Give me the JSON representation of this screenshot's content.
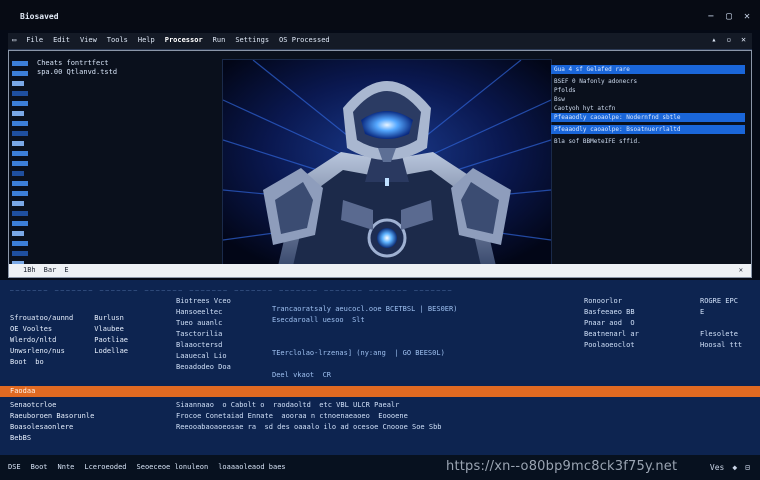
{
  "window": {
    "title": "Biosaved",
    "controls": [
      "−",
      "▢",
      "✕"
    ]
  },
  "toolbar": {
    "items": [
      "▭",
      "File",
      "Edit",
      "View",
      "Tools",
      "Help",
      "Processor",
      "Run",
      "Settings",
      "OS Processed"
    ],
    "right": [
      "▴",
      "▫",
      "✕"
    ]
  },
  "top_panel": {
    "info_lines": [
      "Cheats fontrtfect",
      "spa.00 Qtlanvd.tstd"
    ],
    "right_info": [
      {
        "text": "Gua 4 sf Gelafed rare",
        "style": "blue"
      },
      {
        "text": "BSEF 0 Nafonly adonecrs",
        "style": "dark"
      },
      {
        "text": "Pfolds",
        "style": "dark"
      },
      {
        "text": "Bsw",
        "style": "dark"
      },
      {
        "text": "Caotyoh hyt atcfn",
        "style": "dark"
      },
      {
        "text": "Pfeaaodly caoaolpe: Nodernfnd sbtle",
        "style": "blue"
      },
      {
        "text": "Pfeaaodly caoaolpe: Bsoatnuerrlaltd",
        "style": "blue"
      },
      {
        "text": "Bla sof BBMeteIFE sffid.",
        "style": "dark"
      }
    ],
    "status_items": [
      "1Bh",
      "Bar",
      "E"
    ],
    "status_close": "✕"
  },
  "bottom_panel": {
    "separator": "_______  _______  _______  _______  _______  _______  _______  _______  _______  _______",
    "col1": "\nSfrouatoo/aunnd     Burlusn\nOE Vooltes          Vlaubee\nWlerdo/nltd         Paotliae\nUnwsrleno/nus       Lodellae\nBoot  bo",
    "col2": "Biotrees Vceo\nHansoeeltec\nTueo auanlc\nTasctorilia\nBlaaoctersd\nLaauecal Lio\nBeoadodeo Doa",
    "col3": "Trancaoratsaly aeucocl.ooe BCETBSL | BES0ER)\nEsecdaroall uesoo  Slt\n\n\nTEerclolao-lrzenas] (ny:ang  | GO BEES0L)\n\nDeel vkaot  CR",
    "col4": "Ronoorlor\nBasfeeaeo BB\nPnaar aod  O\nBeatnenarl ar\nPoolaoeoclot",
    "col5": "ROGRE EPC\nE\n\nFlesolete\nHoosal ttt",
    "orange_label": "Faodaa",
    "lower_col1": "Senaotcrloe\nRaeuboroen Basorunle\nBoasolesaonlere\nBebBS",
    "lower_col2": "Siaannaao  o Cabolt o  raodaoltd  etc VBL ULCR Paealr\nFrocoe Conetaiad Ennate  aooraa n ctnoenaeaoeo  Eoooene\nReeooabaoaoeosae ra  sd des oaaalo ilo ad ocesoe Cnoooe Soe Sbb"
  },
  "taskbar": {
    "items": [
      "DSE",
      "Boot",
      "Nnte",
      "Lceroeoded",
      "Seoeceoe lonuleon",
      "loaaaoleaod baes"
    ],
    "url": "https://xn--o80bp9mc8ck3f75y.net",
    "right": [
      "Ves",
      "◆",
      "⊟"
    ]
  },
  "colors": {
    "accent": "#1a66d9",
    "panel_bg": "#0d2450",
    "highlight": "#e06a22"
  }
}
